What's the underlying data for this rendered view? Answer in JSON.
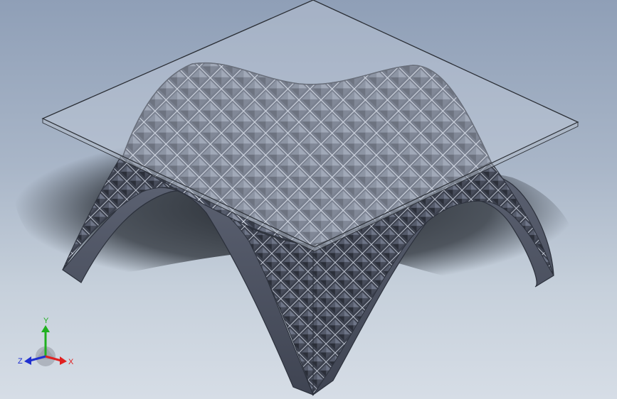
{
  "viewport": {
    "background_top": "#8f9fb7",
    "background_bottom": "#d6dde6"
  },
  "model": {
    "shell_color": "#6c7384",
    "shell_edge_color": "#2c313c",
    "glass_color": "#c7d0dc",
    "shadow_color": "#1f2329"
  },
  "triad": {
    "x_label": "X",
    "y_label": "Y",
    "z_label": "Z",
    "x_color": "#e02020",
    "y_color": "#20b020",
    "z_color": "#2030d0"
  }
}
